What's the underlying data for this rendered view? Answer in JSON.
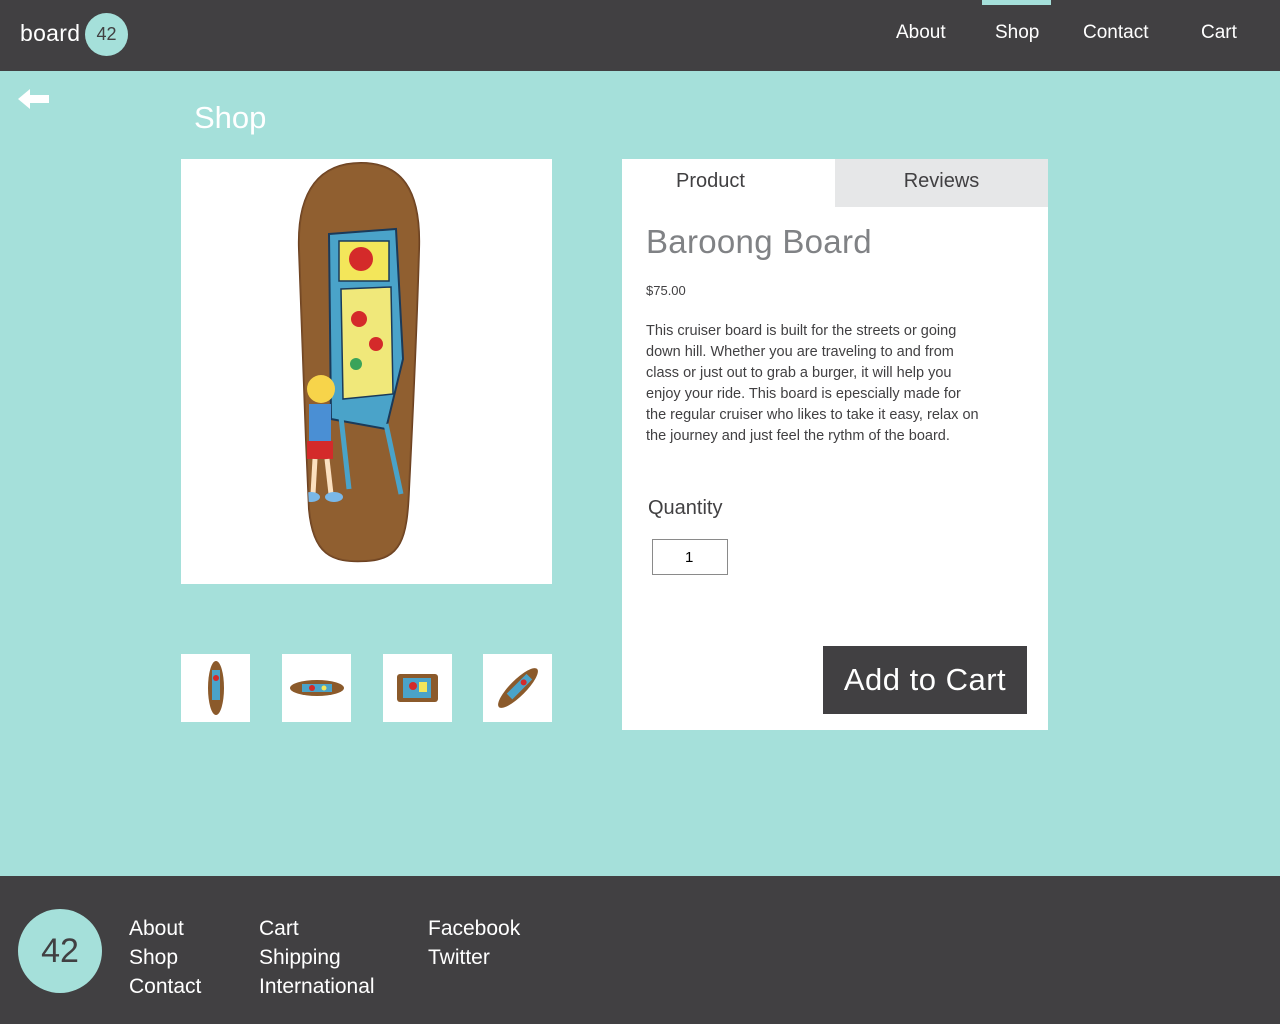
{
  "header": {
    "logo_text": "board",
    "logo_number": "42",
    "nav": {
      "about": "About",
      "shop": "Shop",
      "contact": "Contact",
      "cart": "Cart"
    },
    "active_nav": "Shop"
  },
  "back_icon": "arrow-left-icon",
  "page_title": "Shop",
  "gallery": {
    "main_image": "skateboard-pinball-graphic",
    "thumbnails": [
      "board-front-view",
      "board-side-view",
      "board-top-flat-view",
      "board-angled-view"
    ]
  },
  "product": {
    "tabs": {
      "product": "Product",
      "reviews": "Reviews"
    },
    "active_tab": "Product",
    "title": "Baroong Board",
    "price": "$75.00",
    "description": "This cruiser  board is built for the streets or going down hill. Whether you are traveling to and from class or just out to grab a burger, it will help you enjoy your ride. This board is epescially made for the regular cruiser who likes to take it easy, relax on the journey and just feel the rythm of the board.",
    "quantity_label": "Quantity",
    "quantity_value": "1",
    "add_to_cart": "Add to Cart"
  },
  "footer": {
    "logo_number": "42",
    "col1": [
      "About",
      "Shop",
      "Contact"
    ],
    "col2": [
      "Cart",
      "Shipping",
      "International"
    ],
    "col3": [
      "Facebook",
      "Twitter"
    ]
  },
  "colors": {
    "accent": "#a5e0da",
    "dark": "#414042",
    "tab_inactive": "#e6e7e8",
    "title_gray": "#808285"
  }
}
